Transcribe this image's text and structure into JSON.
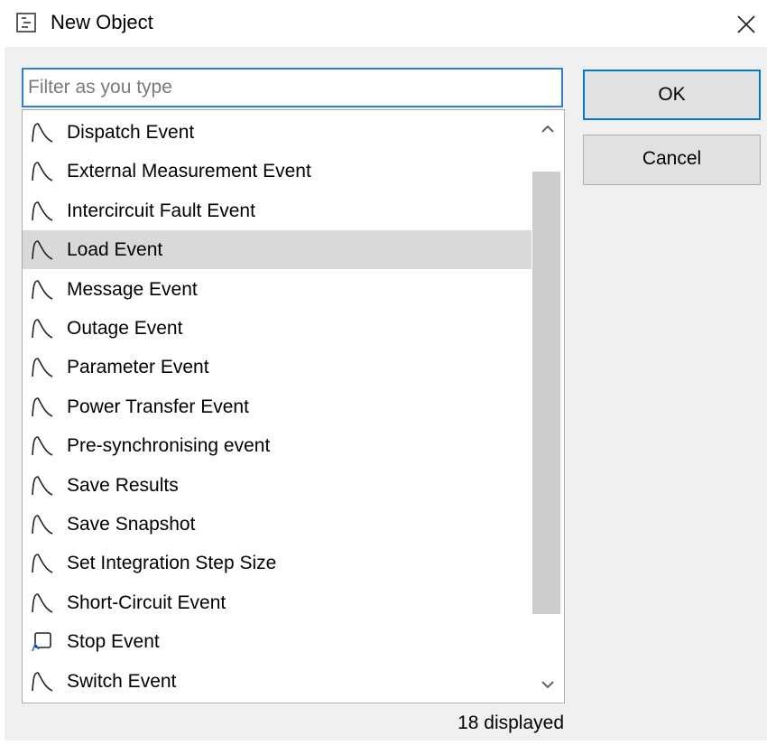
{
  "window": {
    "title": "New Object",
    "title_icon": "dialog-icon",
    "close_icon": "close-icon"
  },
  "filter": {
    "value": "",
    "placeholder": "Filter as you type"
  },
  "list": {
    "items": [
      {
        "label": "Dispatch Event",
        "icon": "event-curve-icon",
        "selected": false
      },
      {
        "label": "External Measurement Event",
        "icon": "event-curve-icon",
        "selected": false
      },
      {
        "label": "Intercircuit Fault Event",
        "icon": "event-curve-icon",
        "selected": false
      },
      {
        "label": "Load Event",
        "icon": "event-curve-icon",
        "selected": true
      },
      {
        "label": "Message Event",
        "icon": "event-curve-icon",
        "selected": false
      },
      {
        "label": "Outage Event",
        "icon": "event-curve-icon",
        "selected": false
      },
      {
        "label": "Parameter Event",
        "icon": "event-curve-icon",
        "selected": false
      },
      {
        "label": "Power Transfer Event",
        "icon": "event-curve-icon",
        "selected": false
      },
      {
        "label": "Pre-synchronising event",
        "icon": "event-curve-icon",
        "selected": false
      },
      {
        "label": "Save Results",
        "icon": "event-curve-icon",
        "selected": false
      },
      {
        "label": "Save Snapshot",
        "icon": "event-curve-icon",
        "selected": false
      },
      {
        "label": "Set Integration Step Size",
        "icon": "event-curve-icon",
        "selected": false
      },
      {
        "label": "Short-Circuit Event",
        "icon": "event-curve-icon",
        "selected": false
      },
      {
        "label": "Stop Event",
        "icon": "stop-event-icon",
        "selected": false
      },
      {
        "label": "Switch Event",
        "icon": "event-curve-icon",
        "selected": false
      }
    ]
  },
  "status": {
    "count_text": "18 displayed"
  },
  "buttons": {
    "ok_label": "OK",
    "cancel_label": "Cancel"
  },
  "colors": {
    "focus_border": "#2f7fd0",
    "selected_row": "#d9d9d9",
    "dialog_background": "#f0f0f0"
  }
}
